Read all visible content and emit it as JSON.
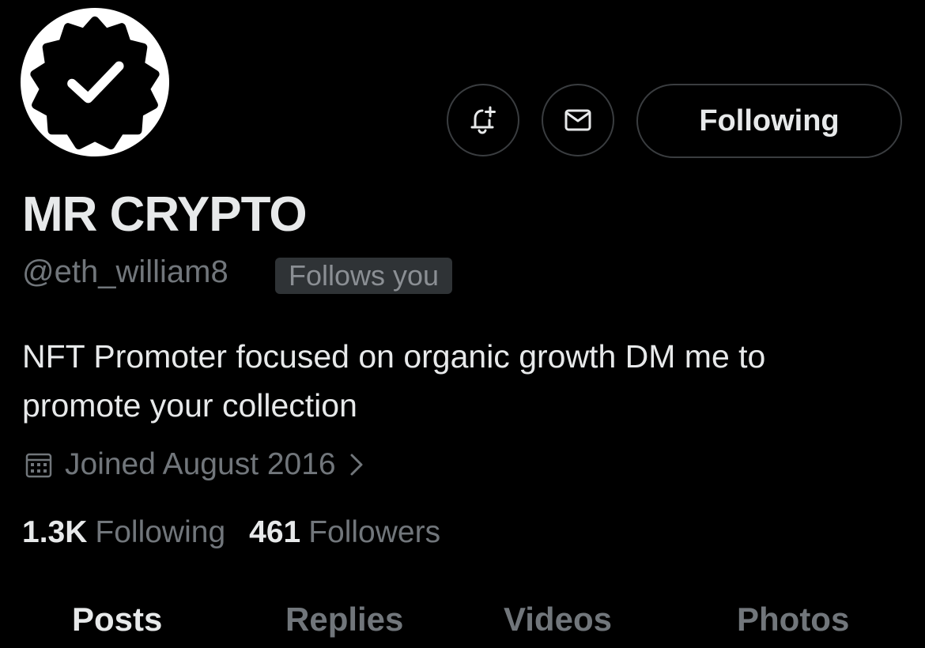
{
  "profile": {
    "display_name": "MR CRYPTO",
    "handle": "@eth_william8",
    "follows_you": "Follows you",
    "bio": "NFT Promoter focused on organic growth DM me to promote your collection",
    "joined": "Joined August 2016",
    "avatar_icon": "verified-badge-icon"
  },
  "actions": {
    "notify_icon": "bell-plus-icon",
    "message_icon": "envelope-icon",
    "follow_label": "Following"
  },
  "stats": {
    "following_count": "1.3K",
    "following_label": "Following",
    "followers_count": "461",
    "followers_label": "Followers"
  },
  "tabs": [
    {
      "label": "Posts",
      "active": true
    },
    {
      "label": "Replies",
      "active": false
    },
    {
      "label": "Videos",
      "active": false
    },
    {
      "label": "Photos",
      "active": false
    }
  ],
  "colors": {
    "background": "#000000",
    "primary_text": "#e7e9ea",
    "secondary_text": "#71767b",
    "badge_bg": "#2f3336"
  }
}
